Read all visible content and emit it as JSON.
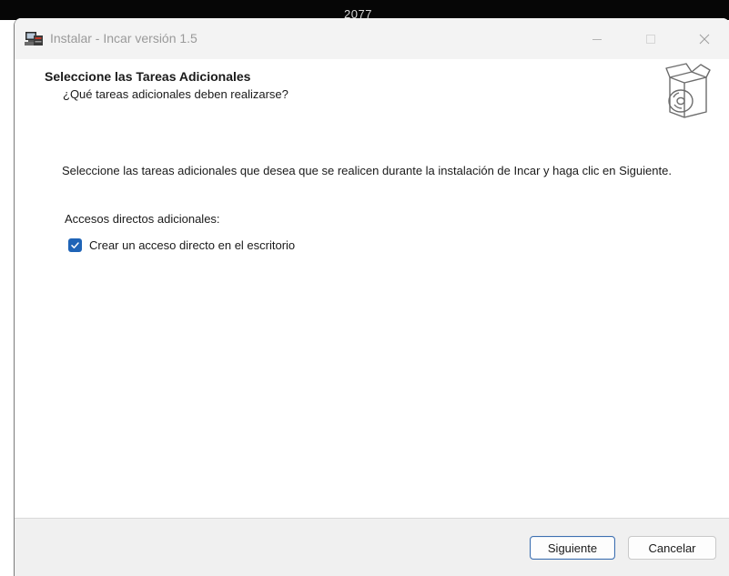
{
  "desktop": {
    "background_text": "2077"
  },
  "window": {
    "title": "Instalar - Incar versión 1.5",
    "app_icon": "installer-computer-icon",
    "controls": {
      "minimize_icon": "minimize-icon",
      "maximize_icon": "maximize-icon",
      "close_icon": "close-icon"
    }
  },
  "page": {
    "heading": "Seleccione las Tareas Adicionales",
    "subheading": "¿Qué tareas adicionales deben realizarse?",
    "header_icon": "package-box-disc-icon",
    "description": "Seleccione las tareas adicionales que desea que se realicen durante la instalación de Incar y haga clic en Siguiente.",
    "group_label": "Accesos directos adicionales:",
    "tasks": [
      {
        "label": "Crear un acceso directo en el escritorio",
        "checked": true
      }
    ]
  },
  "footer": {
    "next_label": "Siguiente",
    "cancel_label": "Cancelar"
  },
  "colors": {
    "accent": "#1f64b7",
    "footer_bg": "#f0f0f0",
    "titlebar_bg": "#f3f3f3"
  }
}
